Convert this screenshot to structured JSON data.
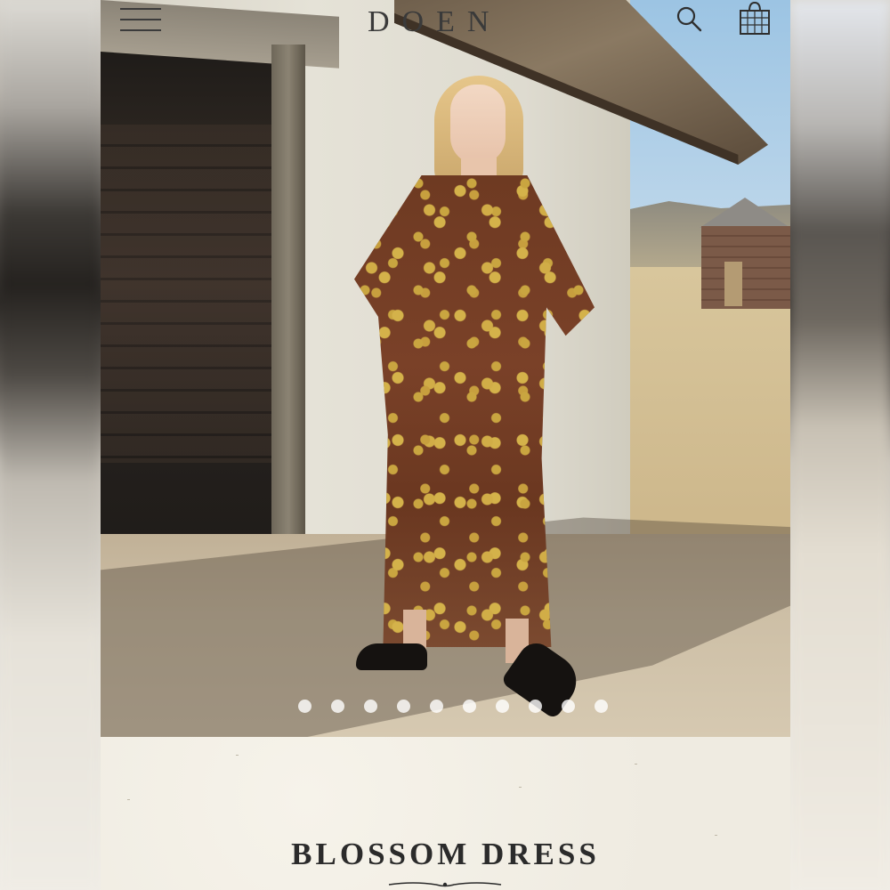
{
  "header": {
    "logo_text": "DOEN",
    "menu_icon": "hamburger-menu-icon",
    "search_icon": "search-icon",
    "bag_icon": "shopping-bag-icon"
  },
  "carousel": {
    "dot_count": 10,
    "active_index": 0
  },
  "product": {
    "name": "BLOSSOM DRESS"
  },
  "colors": {
    "background": "#f2efe6",
    "text": "#2b2b2b",
    "dot": "#ffffff"
  }
}
